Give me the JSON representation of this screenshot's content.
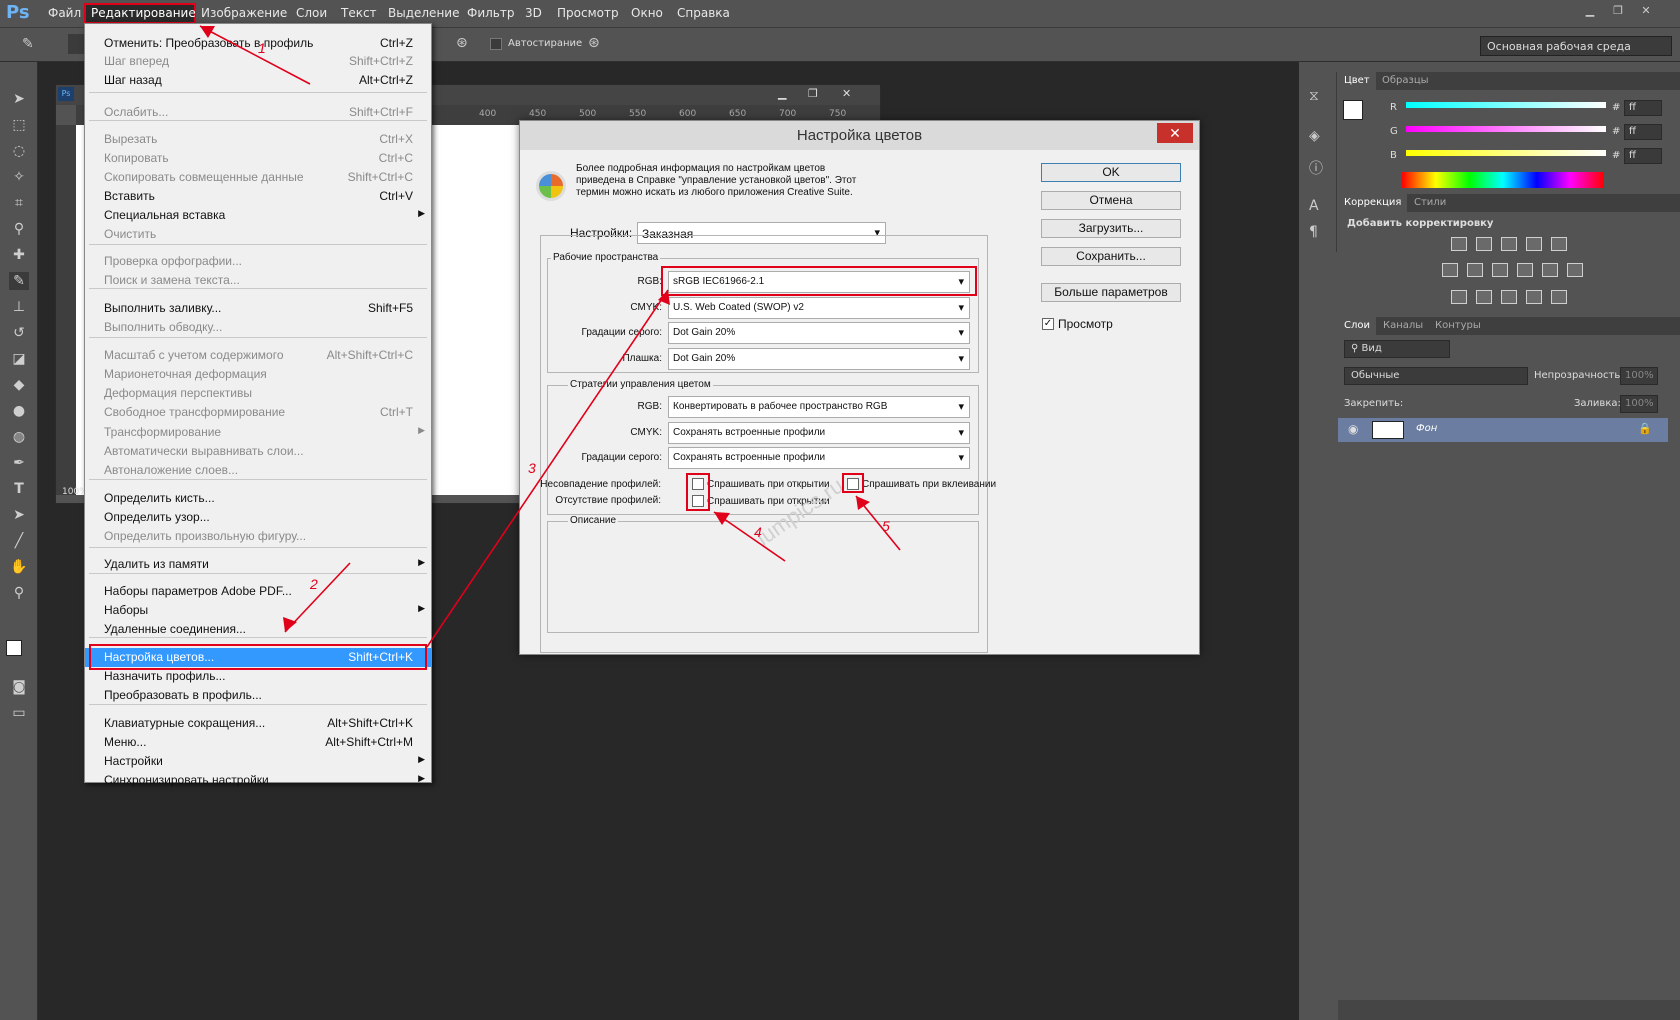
{
  "app": {
    "logo": "Ps"
  },
  "menubar": {
    "items": [
      "Файл",
      "Редактирование",
      "Изображение",
      "Слои",
      "Текст",
      "Выделение",
      "Фильтр",
      "3D",
      "Просмотр",
      "Окно",
      "Справка"
    ]
  },
  "options_bar": {
    "autoerase_label": "Автостирание",
    "workspace": "Основная рабочая среда"
  },
  "document": {
    "zoom": "100%",
    "ruler_ticks": [
      "400",
      "450",
      "500",
      "550",
      "600",
      "650",
      "700",
      "750"
    ]
  },
  "edit_menu": {
    "items": [
      {
        "label": "Отменить: Преобразовать в профиль",
        "shortcut": "Ctrl+Z",
        "enabled": true
      },
      {
        "label": "Шаг вперед",
        "shortcut": "Shift+Ctrl+Z",
        "enabled": false
      },
      {
        "label": "Шаг назад",
        "shortcut": "Alt+Ctrl+Z",
        "enabled": true
      },
      {
        "label": "Ослабить...",
        "shortcut": "Shift+Ctrl+F",
        "enabled": false
      },
      {
        "label": "Вырезать",
        "shortcut": "Ctrl+X",
        "enabled": false
      },
      {
        "label": "Копировать",
        "shortcut": "Ctrl+C",
        "enabled": false
      },
      {
        "label": "Скопировать совмещенные данные",
        "shortcut": "Shift+Ctrl+C",
        "enabled": false
      },
      {
        "label": "Вставить",
        "shortcut": "Ctrl+V",
        "enabled": true
      },
      {
        "label": "Специальная вставка",
        "shortcut": "",
        "enabled": true,
        "submenu": true
      },
      {
        "label": "Очистить",
        "shortcut": "",
        "enabled": false
      },
      {
        "label": "Проверка орфографии...",
        "shortcut": "",
        "enabled": false
      },
      {
        "label": "Поиск и замена текста...",
        "shortcut": "",
        "enabled": false
      },
      {
        "label": "Выполнить заливку...",
        "shortcut": "Shift+F5",
        "enabled": true
      },
      {
        "label": "Выполнить обводку...",
        "shortcut": "",
        "enabled": false
      },
      {
        "label": "Масштаб с учетом содержимого",
        "shortcut": "Alt+Shift+Ctrl+C",
        "enabled": false
      },
      {
        "label": "Марионеточная деформация",
        "shortcut": "",
        "enabled": false
      },
      {
        "label": "Деформация перспективы",
        "shortcut": "",
        "enabled": false
      },
      {
        "label": "Свободное трансформирование",
        "shortcut": "Ctrl+T",
        "enabled": false
      },
      {
        "label": "Трансформирование",
        "shortcut": "",
        "enabled": false,
        "submenu": true
      },
      {
        "label": "Автоматически выравнивать слои...",
        "shortcut": "",
        "enabled": false
      },
      {
        "label": "Автоналожение слоев...",
        "shortcut": "",
        "enabled": false
      },
      {
        "label": "Определить кисть...",
        "shortcut": "",
        "enabled": true
      },
      {
        "label": "Определить узор...",
        "shortcut": "",
        "enabled": true
      },
      {
        "label": "Определить произвольную фигуру...",
        "shortcut": "",
        "enabled": false
      },
      {
        "label": "Удалить из памяти",
        "shortcut": "",
        "enabled": true,
        "submenu": true
      },
      {
        "label": "Наборы параметров Adobe PDF...",
        "shortcut": "",
        "enabled": true
      },
      {
        "label": "Наборы",
        "shortcut": "",
        "enabled": true,
        "submenu": true
      },
      {
        "label": "Удаленные соединения...",
        "shortcut": "",
        "enabled": true
      },
      {
        "label": "Настройка цветов...",
        "shortcut": "Shift+Ctrl+K",
        "enabled": true,
        "highlighted": true
      },
      {
        "label": "Назначить профиль...",
        "shortcut": "",
        "enabled": true
      },
      {
        "label": "Преобразовать в профиль...",
        "shortcut": "",
        "enabled": true
      },
      {
        "label": "Клавиатурные сокращения...",
        "shortcut": "Alt+Shift+Ctrl+K",
        "enabled": true
      },
      {
        "label": "Меню...",
        "shortcut": "Alt+Shift+Ctrl+M",
        "enabled": true
      },
      {
        "label": "Настройки",
        "shortcut": "",
        "enabled": true,
        "submenu": true
      },
      {
        "label": "Синхронизировать настройки",
        "shortcut": "",
        "enabled": true,
        "submenu": true
      }
    ]
  },
  "dialog": {
    "title": "Настройка цветов",
    "info": "Более подробная информация по настройкам цветов приведена в Справке \"управление установкой цветов\". Этот термин можно искать из любого приложения Creative Suite.",
    "settings_label": "Настройки:",
    "settings_value": "Заказная",
    "working_spaces": {
      "legend": "Рабочие пространства",
      "rgb_label": "RGB:",
      "rgb_value": "sRGB IEC61966-2.1",
      "cmyk_label": "CMYK:",
      "cmyk_value": "U.S. Web Coated (SWOP) v2",
      "gray_label": "Градации серого:",
      "gray_value": "Dot Gain 20%",
      "spot_label": "Плашка:",
      "spot_value": "Dot Gain 20%"
    },
    "policies": {
      "legend": "Стратегии управления цветом",
      "rgb_label": "RGB:",
      "rgb_value": "Конвертировать в рабочее пространство RGB",
      "cmyk_label": "CMYK:",
      "cmyk_value": "Сохранять встроенные профили",
      "gray_label": "Градации серого:",
      "gray_value": "Сохранять встроенные профили",
      "mismatch_label": "Несовпадение профилей:",
      "mismatch_open": "Спрашивать при открытии",
      "mismatch_paste": "Спрашивать при вклеивании",
      "missing_label": "Отсутствие профилей:",
      "missing_open": "Спрашивать при открытии"
    },
    "description_legend": "Описание",
    "buttons": {
      "ok": "OK",
      "cancel": "Отмена",
      "load": "Загрузить...",
      "save": "Сохранить...",
      "more": "Больше параметров"
    },
    "preview_label": "Просмотр",
    "preview_checked": true
  },
  "annotations": {
    "steps": [
      "1",
      "2",
      "3",
      "4",
      "5"
    ]
  },
  "watermark": "lumpics.ru",
  "color_panel": {
    "tabs": [
      "Цвет",
      "Образцы"
    ],
    "channels": [
      {
        "label": "R",
        "value": "ff"
      },
      {
        "label": "G",
        "value": "ff"
      },
      {
        "label": "B",
        "value": "ff"
      }
    ],
    "hash": "#"
  },
  "adjustments_panel": {
    "tabs": [
      "Коррекция",
      "Стили"
    ],
    "heading": "Добавить корректировку"
  },
  "layers_panel": {
    "tabs": [
      "Слои",
      "Каналы",
      "Контуры"
    ],
    "filter": "Вид",
    "blend_mode": "Обычные",
    "opacity_label": "Непрозрачность:",
    "opacity": "100%",
    "lock_label": "Закрепить:",
    "fill_label": "Заливка:",
    "fill": "100%",
    "layers": [
      {
        "name": "Фон"
      }
    ]
  },
  "colors": {
    "accent_red": "#e0001a",
    "highlight": "#3399ff"
  }
}
